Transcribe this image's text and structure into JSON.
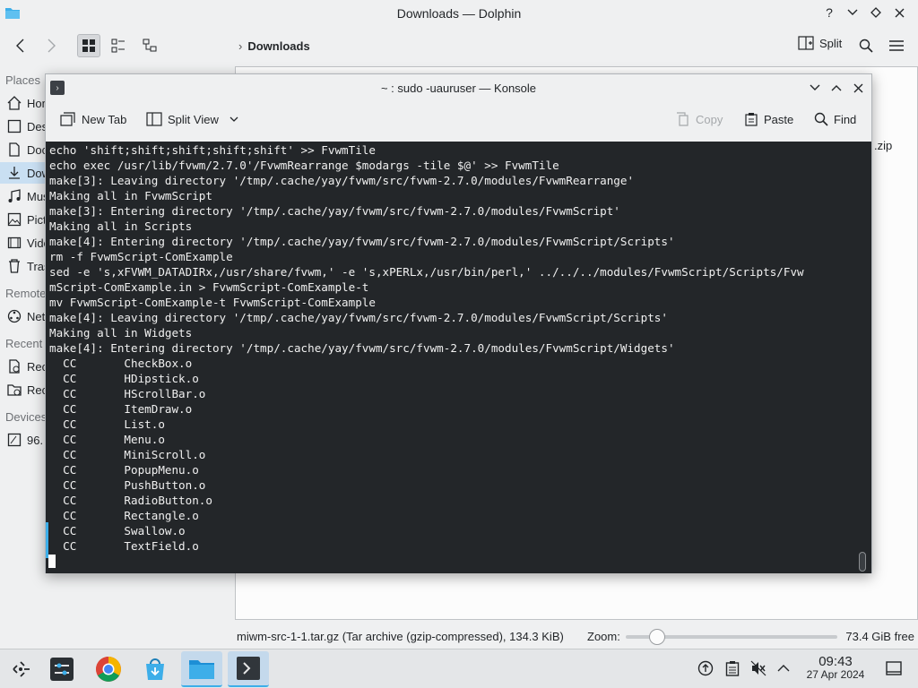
{
  "dolphin": {
    "title": "Downloads — Dolphin",
    "breadcrumb": "Downloads",
    "split_label": "Split",
    "places_heading": "Places",
    "places": [
      {
        "label": "Home",
        "icon": "home-icon"
      },
      {
        "label": "Desktop",
        "icon": "desktop-icon"
      },
      {
        "label": "Documents",
        "icon": "documents-icon"
      },
      {
        "label": "Downloads",
        "icon": "downloads-icon"
      },
      {
        "label": "Music",
        "icon": "music-icon"
      },
      {
        "label": "Pictures",
        "icon": "pictures-icon"
      },
      {
        "label": "Videos",
        "icon": "videos-icon"
      },
      {
        "label": "Trash",
        "icon": "trash-icon"
      }
    ],
    "remote_heading": "Remote",
    "remote_items": [
      {
        "label": "Network",
        "icon": "network-icon"
      }
    ],
    "recent_heading": "Recent",
    "recent_items": [
      {
        "label": "Recent Files",
        "icon": "recent-files-icon"
      },
      {
        "label": "Recent Locations",
        "icon": "recent-locations-icon"
      }
    ],
    "devices_heading": "Devices",
    "device_items": [
      {
        "label": "96.",
        "icon": "drive-icon"
      }
    ],
    "visible_file_suffix": ".zip",
    "status": {
      "file_info": "miwm-src-1-1.tar.gz (Tar archive (gzip-compressed), 134.3 KiB)",
      "zoom_label": "Zoom:",
      "zoom_level": 0.12,
      "free_space": "73.4 GiB free"
    }
  },
  "konsole": {
    "title": "~ : sudo -uauruser — Konsole",
    "toolbar": {
      "new_tab": "New Tab",
      "split_view": "Split View",
      "copy": "Copy",
      "paste": "Paste",
      "find": "Find"
    },
    "terminal_lines": [
      "echo 'shift;shift;shift;shift;shift' >> FvwmTile",
      "echo exec /usr/lib/fvwm/2.7.0'/FvwmRearrange $modargs -tile $@' >> FvwmTile",
      "make[3]: Leaving directory '/tmp/.cache/yay/fvwm/src/fvwm-2.7.0/modules/FvwmRearrange'",
      "Making all in FvwmScript",
      "make[3]: Entering directory '/tmp/.cache/yay/fvwm/src/fvwm-2.7.0/modules/FvwmScript'",
      "Making all in Scripts",
      "make[4]: Entering directory '/tmp/.cache/yay/fvwm/src/fvwm-2.7.0/modules/FvwmScript/Scripts'",
      "rm -f FvwmScript-ComExample",
      "sed -e 's,xFVWM_DATADIRx,/usr/share/fvwm,' -e 's,xPERLx,/usr/bin/perl,' ../../../modules/FvwmScript/Scripts/Fvw",
      "mScript-ComExample.in > FvwmScript-ComExample-t",
      "mv FvwmScript-ComExample-t FvwmScript-ComExample",
      "make[4]: Leaving directory '/tmp/.cache/yay/fvwm/src/fvwm-2.7.0/modules/FvwmScript/Scripts'",
      "Making all in Widgets",
      "make[4]: Entering directory '/tmp/.cache/yay/fvwm/src/fvwm-2.7.0/modules/FvwmScript/Widgets'",
      "  CC       CheckBox.o",
      "  CC       HDipstick.o",
      "  CC       HScrollBar.o",
      "  CC       ItemDraw.o",
      "  CC       List.o",
      "  CC       Menu.o",
      "  CC       MiniScroll.o",
      "  CC       PopupMenu.o",
      "  CC       PushButton.o",
      "  CC       RadioButton.o",
      "  CC       Rectangle.o",
      "  CC       Swallow.o",
      "  CC       TextField.o"
    ]
  },
  "taskbar": {
    "time": "09:43",
    "date": "27 Apr 2024"
  },
  "colors": {
    "terminal_bg": "#232629",
    "terminal_fg": "#f0f0f0",
    "accent": "#3daee9"
  }
}
